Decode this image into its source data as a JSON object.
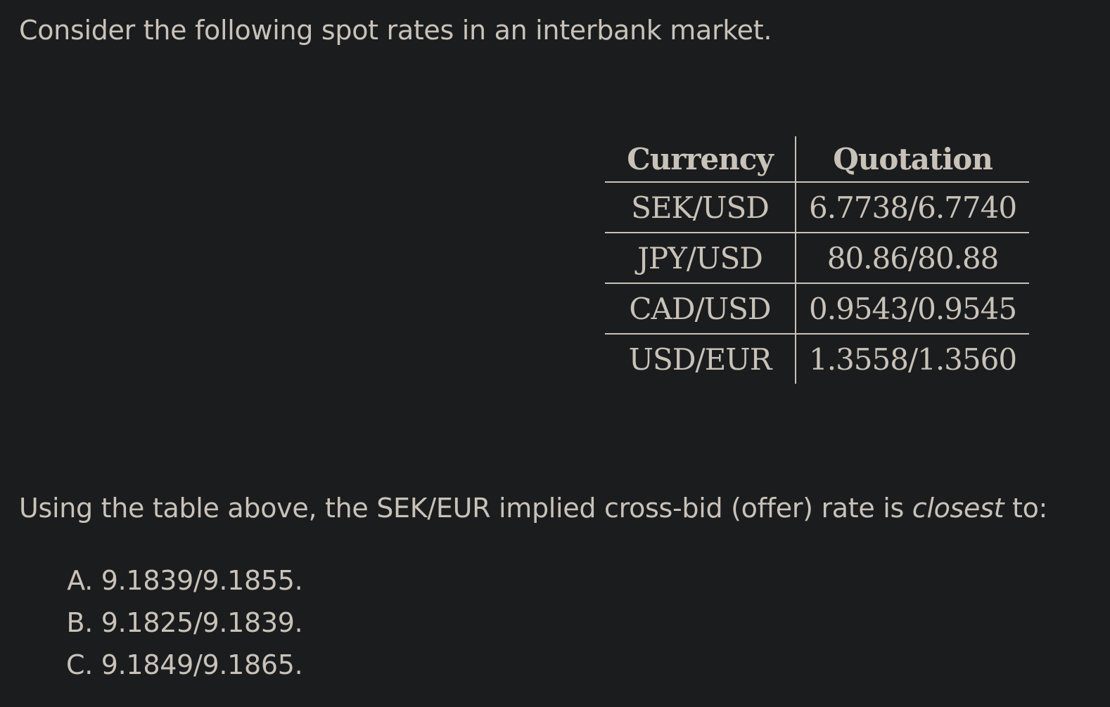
{
  "intro_text": "Consider the following spot rates in an interbank market.",
  "table": {
    "headers": [
      "Currency",
      "Quotation"
    ],
    "rows": [
      {
        "currency": "SEK/USD",
        "quotation": "6.7738/6.7740"
      },
      {
        "currency": "JPY/USD",
        "quotation": "80.86/80.88"
      },
      {
        "currency": "CAD/USD",
        "quotation": "0.9543/0.9545"
      },
      {
        "currency": "USD/EUR",
        "quotation": "1.3558/1.3560"
      }
    ]
  },
  "question": {
    "prefix": "Using the table above, the SEK/EUR implied cross-bid (offer) rate is ",
    "emphasis": "closest",
    "suffix": " to:"
  },
  "options": [
    {
      "letter": "A.",
      "text": "9.1839/9.1855."
    },
    {
      "letter": "B.",
      "text": "9.1825/9.1839."
    },
    {
      "letter": "C.",
      "text": "9.1849/9.1865."
    }
  ]
}
